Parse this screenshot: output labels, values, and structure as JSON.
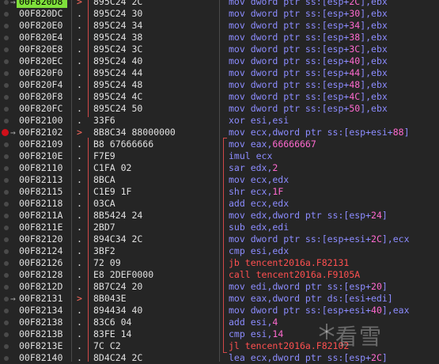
{
  "colors": {
    "selected_address_bg": "#7fe03b",
    "instruction": "#8c8cff",
    "call_jump": "#ff5050",
    "immediate": "#ff6ad0",
    "breakpoint": "#d0101a"
  },
  "rows": [
    {
      "addr": "00F820D8",
      "mark": ">",
      "bytes": "895C24 2C",
      "asm": [
        {
          "t": "mov dword ptr ss:[esp+"
        },
        {
          "t": "2C",
          "n": 1
        },
        {
          "t": "],ebx"
        }
      ],
      "sel": true,
      "arrow": true
    },
    {
      "addr": "00F820DC",
      "mark": ".",
      "bytes": "895C24 30",
      "asm": [
        {
          "t": "mov dword ptr ss:[esp+"
        },
        {
          "t": "30",
          "n": 1
        },
        {
          "t": "],ebx"
        }
      ]
    },
    {
      "addr": "00F820E0",
      "mark": ".",
      "bytes": "895C24 34",
      "asm": [
        {
          "t": "mov dword ptr ss:[esp+"
        },
        {
          "t": "34",
          "n": 1
        },
        {
          "t": "],ebx"
        }
      ]
    },
    {
      "addr": "00F820E4",
      "mark": ".",
      "bytes": "895C24 38",
      "asm": [
        {
          "t": "mov dword ptr ss:[esp+"
        },
        {
          "t": "38",
          "n": 1
        },
        {
          "t": "],ebx"
        }
      ]
    },
    {
      "addr": "00F820E8",
      "mark": ".",
      "bytes": "895C24 3C",
      "asm": [
        {
          "t": "mov dword ptr ss:[esp+"
        },
        {
          "t": "3C",
          "n": 1
        },
        {
          "t": "],ebx"
        }
      ]
    },
    {
      "addr": "00F820EC",
      "mark": ".",
      "bytes": "895C24 40",
      "asm": [
        {
          "t": "mov dword ptr ss:[esp+"
        },
        {
          "t": "40",
          "n": 1
        },
        {
          "t": "],ebx"
        }
      ]
    },
    {
      "addr": "00F820F0",
      "mark": ".",
      "bytes": "895C24 44",
      "asm": [
        {
          "t": "mov dword ptr ss:[esp+"
        },
        {
          "t": "44",
          "n": 1
        },
        {
          "t": "],ebx"
        }
      ]
    },
    {
      "addr": "00F820F4",
      "mark": ".",
      "bytes": "895C24 48",
      "asm": [
        {
          "t": "mov dword ptr ss:[esp+"
        },
        {
          "t": "48",
          "n": 1
        },
        {
          "t": "],ebx"
        }
      ]
    },
    {
      "addr": "00F820F8",
      "mark": ".",
      "bytes": "895C24 4C",
      "asm": [
        {
          "t": "mov dword ptr ss:[esp+"
        },
        {
          "t": "4C",
          "n": 1
        },
        {
          "t": "],ebx"
        }
      ]
    },
    {
      "addr": "00F820FC",
      "mark": ".",
      "bytes": "895C24 50",
      "asm": [
        {
          "t": "mov dword ptr ss:[esp+"
        },
        {
          "t": "50",
          "n": 1
        },
        {
          "t": "],ebx"
        }
      ]
    },
    {
      "addr": "00F82100",
      "mark": ".",
      "bytes": "33F6",
      "asm": [
        {
          "t": "xor esi,esi"
        }
      ]
    },
    {
      "addr": "00F82102",
      "mark": ">",
      "bytes": "8B8C34 88000000",
      "asm": [
        {
          "t": "mov ecx,dword ptr ss:[esp+esi+"
        },
        {
          "t": "88",
          "n": 1
        },
        {
          "t": "]"
        }
      ],
      "bp": true
    },
    {
      "addr": "00F82109",
      "mark": ".",
      "bytes": "B8 67666666",
      "asm": [
        {
          "t": "mov eax,"
        },
        {
          "t": "66666667",
          "n": 1
        }
      ]
    },
    {
      "addr": "00F8210E",
      "mark": ".",
      "bytes": "F7E9",
      "asm": [
        {
          "t": "imul ecx"
        }
      ]
    },
    {
      "addr": "00F82110",
      "mark": ".",
      "bytes": "C1FA 02",
      "asm": [
        {
          "t": "sar edx,"
        },
        {
          "t": "2",
          "n": 1
        }
      ]
    },
    {
      "addr": "00F82113",
      "mark": ".",
      "bytes": "8BCA",
      "asm": [
        {
          "t": "mov ecx,edx"
        }
      ]
    },
    {
      "addr": "00F82115",
      "mark": ".",
      "bytes": "C1E9 1F",
      "asm": [
        {
          "t": "shr ecx,"
        },
        {
          "t": "1F",
          "n": 1
        }
      ]
    },
    {
      "addr": "00F82118",
      "mark": ".",
      "bytes": "03CA",
      "asm": [
        {
          "t": "add ecx,edx"
        }
      ]
    },
    {
      "addr": "00F8211A",
      "mark": ".",
      "bytes": "8B5424 24",
      "asm": [
        {
          "t": "mov edx,dword ptr ss:[esp+"
        },
        {
          "t": "24",
          "n": 1
        },
        {
          "t": "]"
        }
      ]
    },
    {
      "addr": "00F8211E",
      "mark": ".",
      "bytes": "2BD7",
      "asm": [
        {
          "t": "sub edx,edi"
        }
      ]
    },
    {
      "addr": "00F82120",
      "mark": ".",
      "bytes": "894C34 2C",
      "asm": [
        {
          "t": "mov dword ptr ss:[esp+esi+"
        },
        {
          "t": "2C",
          "n": 1
        },
        {
          "t": "],ecx"
        }
      ]
    },
    {
      "addr": "00F82124",
      "mark": ".",
      "bytes": "3BF2",
      "asm": [
        {
          "t": "cmp esi,edx"
        }
      ]
    },
    {
      "addr": "00F82126",
      "mark": ".",
      "bytes": "72 09",
      "asm": [
        {
          "t": "jb tencent2016a.F82131"
        }
      ],
      "jmp": true
    },
    {
      "addr": "00F82128",
      "mark": ".",
      "bytes": "E8 2DEF0000",
      "asm": [
        {
          "t": "call tencent2016a.F9105A"
        }
      ],
      "jmp": true
    },
    {
      "addr": "00F8212D",
      "mark": ".",
      "bytes": "8B7C24 20",
      "asm": [
        {
          "t": "mov edi,dword ptr ss:[esp+"
        },
        {
          "t": "20",
          "n": 1
        },
        {
          "t": "]"
        }
      ]
    },
    {
      "addr": "00F82131",
      "mark": ">",
      "bytes": "8B043E",
      "asm": [
        {
          "t": "mov eax,dword ptr ds:[esi+edi]"
        }
      ],
      "arrow": true
    },
    {
      "addr": "00F82134",
      "mark": ".",
      "bytes": "894434 40",
      "asm": [
        {
          "t": "mov dword ptr ss:[esp+esi+"
        },
        {
          "t": "40",
          "n": 1
        },
        {
          "t": "],eax"
        }
      ]
    },
    {
      "addr": "00F82138",
      "mark": ".",
      "bytes": "83C6 04",
      "asm": [
        {
          "t": "add esi,"
        },
        {
          "t": "4",
          "n": 1
        }
      ]
    },
    {
      "addr": "00F8213B",
      "mark": ".",
      "bytes": "83FE 14",
      "asm": [
        {
          "t": "cmp esi,"
        },
        {
          "t": "14",
          "n": 1
        }
      ]
    },
    {
      "addr": "00F8213E",
      "mark": ".",
      "bytes": "7C C2",
      "asm": [
        {
          "t": "jl tencent2016a.F82102"
        }
      ],
      "jmp": true
    },
    {
      "addr": "00F82140",
      "mark": ".",
      "bytes": "8D4C24 2C",
      "asm": [
        {
          "t": "lea ecx,dword ptr ss:[esp+"
        },
        {
          "t": "2C",
          "n": 1
        },
        {
          "t": "]"
        }
      ]
    }
  ],
  "watermark": {
    "text": "看雪",
    "icon": "snowflake-icon"
  }
}
